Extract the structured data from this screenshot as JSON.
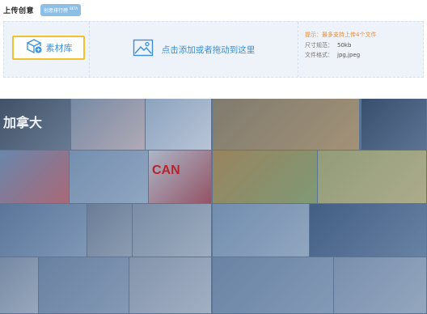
{
  "header": {
    "title": "上传创意",
    "badge": "创意排行榜",
    "badge_sup": "BETA"
  },
  "upload": {
    "library_button": "素材库",
    "drop_label": "点击添加或者拖动到这里",
    "tip": "提示：最多支持上传4个文件",
    "size_label": "尺寸规范：",
    "size_value": "50kb",
    "format_label": "文件格式：",
    "format_value": "jpg,jpeg"
  },
  "gallery": {
    "tiles": [
      {
        "name": "canada-sign-tile",
        "colors": [
          "#3b4758",
          "#6b7c90"
        ],
        "caption": "加拿大"
      },
      {
        "name": "canada-flag-tile",
        "colors": [
          "#7f8fa6",
          "#c9b9bd"
        ]
      },
      {
        "name": "canada-flag-pole-tile",
        "colors": [
          "#9ab0c8",
          "#d3dbe6"
        ]
      },
      {
        "name": "money-coins-tile",
        "colors": [
          "#8a7d62",
          "#b89a6c"
        ]
      },
      {
        "name": "finance-chart-tile",
        "colors": [
          "#2f4460",
          "#5d7391"
        ]
      },
      {
        "name": "canada-flag-wave-tile",
        "colors": [
          "#6e8bb0",
          "#c0656c"
        ]
      },
      {
        "name": "city-skyline-tile",
        "colors": [
          "#7c96b4",
          "#9fb4cb"
        ]
      },
      {
        "name": "canada-text-tile",
        "colors": [
          "#c2c9d4",
          "#a44a55"
        ],
        "caption": "CAN"
      },
      {
        "name": "arrows-graph-tile",
        "colors": [
          "#a9894d",
          "#8aa36a"
        ]
      },
      {
        "name": "coins-stack-tile",
        "colors": [
          "#a3a76f",
          "#c3bb86"
        ]
      },
      {
        "name": "classroom-girls-tile",
        "colors": [
          "#5b7498",
          "#8aa2be"
        ]
      },
      {
        "name": "boys-portrait-tile",
        "colors": [
          "#6f7f95",
          "#9aa7b8"
        ]
      },
      {
        "name": "students-class-tile",
        "colors": [
          "#8293a8",
          "#b0bcc9"
        ]
      },
      {
        "name": "hiker-mountain-tile",
        "colors": [
          "#7794b4",
          "#a2b4c9"
        ]
      },
      {
        "name": "mountain-peak-tile",
        "colors": [
          "#3c587c",
          "#6c86a6"
        ]
      },
      {
        "name": "girls-group-tile",
        "colors": [
          "#7d8ea4",
          "#a9b6c6"
        ]
      },
      {
        "name": "kids-science-tile",
        "colors": [
          "#6d84a2",
          "#8fa3bb"
        ]
      },
      {
        "name": "smiling-girl-tile",
        "colors": [
          "#8e9cb0",
          "#b6c0cd"
        ]
      },
      {
        "name": "cyclist-road-tile",
        "colors": [
          "#6e87a6",
          "#8fa4bd"
        ]
      },
      {
        "name": "car-road-tile",
        "colors": [
          "#8196b1",
          "#a5b5c8"
        ]
      }
    ]
  },
  "colors": {
    "accent_blue": "#3a8fd8",
    "highlight_yellow": "#f2c12e",
    "tip_orange": "#f08a2a",
    "panel_bg": "#eef3f9"
  }
}
